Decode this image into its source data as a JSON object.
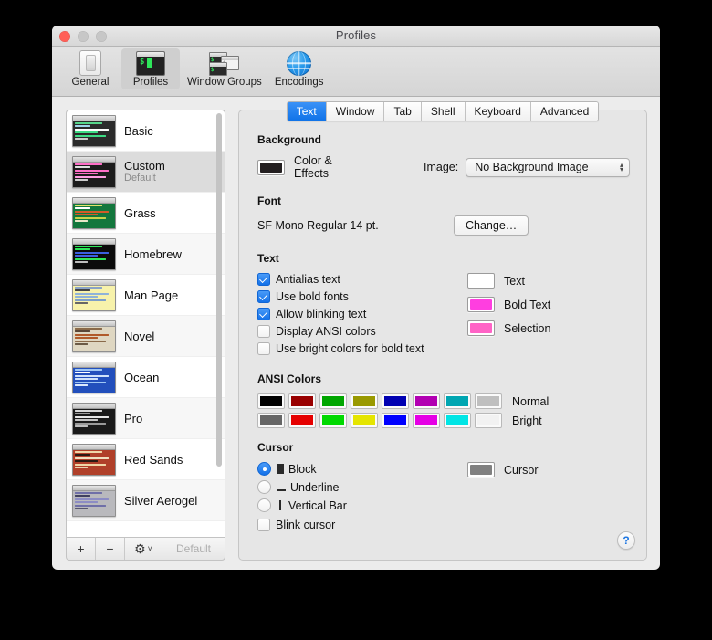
{
  "window": {
    "title": "Profiles",
    "traffic_lights": [
      "close",
      "minimize",
      "zoom"
    ]
  },
  "toolbar": {
    "items": [
      {
        "label": "General",
        "icon": "general-window-icon",
        "selected": false
      },
      {
        "label": "Profiles",
        "icon": "terminal-icon",
        "selected": true
      },
      {
        "label": "Window Groups",
        "icon": "window-groups-icon",
        "selected": false
      },
      {
        "label": "Encodings",
        "icon": "globe-icon",
        "selected": false
      }
    ]
  },
  "sidebar": {
    "profiles": [
      {
        "name": "Basic",
        "subtitle": "",
        "selected": false,
        "thumb": {
          "bg": "#2b2b2b",
          "lines": [
            "#56d68a",
            "#9fd6ea",
            "#ffffff",
            "#3ddc84",
            "#3ddc84",
            "#cccccc"
          ]
        }
      },
      {
        "name": "Custom",
        "subtitle": "Default",
        "selected": true,
        "thumb": {
          "bg": "#1c1c1c",
          "lines": [
            "#ff6ec7",
            "#e0e0e0",
            "#ff6ec7",
            "#ff6ec7",
            "#ff9de2",
            "#cccccc"
          ]
        }
      },
      {
        "name": "Grass",
        "subtitle": "",
        "selected": false,
        "thumb": {
          "bg": "#13773d",
          "lines": [
            "#e3e36a",
            "#ffffff",
            "#d35b29",
            "#d35b29",
            "#c9d14a",
            "#e8e8c8"
          ]
        }
      },
      {
        "name": "Homebrew",
        "subtitle": "",
        "selected": false,
        "thumb": {
          "bg": "#0b0b0b",
          "lines": [
            "#2ee65a",
            "#2ee65a",
            "#3b5fe0",
            "#3b5fe0",
            "#2ee65a",
            "#bdbdbd"
          ]
        }
      },
      {
        "name": "Man Page",
        "subtitle": "",
        "selected": false,
        "thumb": {
          "bg": "#f7f2ab",
          "lines": [
            "#8aa3c7",
            "#444444",
            "#8fb3d9",
            "#8fb3d9",
            "#7d9fc9",
            "#666666"
          ]
        }
      },
      {
        "name": "Novel",
        "subtitle": "",
        "selected": false,
        "thumb": {
          "bg": "#dfd7c2",
          "lines": [
            "#8a6a4a",
            "#5a4636",
            "#b05a2a",
            "#b05a2a",
            "#8a6a4a",
            "#6b5a45"
          ]
        }
      },
      {
        "name": "Ocean",
        "subtitle": "",
        "selected": false,
        "thumb": {
          "bg": "#224fbc",
          "lines": [
            "#9fc7f5",
            "#ffffff",
            "#cfe2fb",
            "#cfe2fb",
            "#9fc7f5",
            "#dbe9fd"
          ]
        }
      },
      {
        "name": "Pro",
        "subtitle": "",
        "selected": false,
        "thumb": {
          "bg": "#1a1a1a",
          "lines": [
            "#d8d8d8",
            "#9a9a9a",
            "#e6e6e6",
            "#c4c4c4",
            "#9a9a9a",
            "#bdbdbd"
          ]
        }
      },
      {
        "name": "Red Sands",
        "subtitle": "",
        "selected": false,
        "thumb": {
          "bg": "#b0402a",
          "lines": [
            "#f0d7a8",
            "#2a1a14",
            "#efe0c0",
            "#2a1a14",
            "#f0d7a8",
            "#e8d2b0"
          ]
        }
      },
      {
        "name": "Silver Aerogel",
        "subtitle": "",
        "selected": false,
        "thumb": {
          "bg": "#b9b9bd",
          "lines": [
            "#6f6fa8",
            "#404060",
            "#8c8cc4",
            "#8c8cc4",
            "#6f6fa8",
            "#55556e"
          ]
        }
      }
    ],
    "footer": {
      "add_label": "+",
      "remove_label": "−",
      "gear_label": "⚙",
      "gear_chevron": "˅",
      "default_label": "Default"
    }
  },
  "tabs": [
    {
      "label": "Text",
      "active": true
    },
    {
      "label": "Window",
      "active": false
    },
    {
      "label": "Tab",
      "active": false
    },
    {
      "label": "Shell",
      "active": false
    },
    {
      "label": "Keyboard",
      "active": false
    },
    {
      "label": "Advanced",
      "active": false
    }
  ],
  "background": {
    "section": "Background",
    "color_effects_label": "Color & Effects",
    "color_swatch": "#231f20",
    "image_label": "Image:",
    "image_value": "No Background Image"
  },
  "font": {
    "section": "Font",
    "value": "SF Mono Regular 14 pt.",
    "change_label": "Change…"
  },
  "text": {
    "section": "Text",
    "checkboxes": [
      {
        "label": "Antialias text",
        "checked": true
      },
      {
        "label": "Use bold fonts",
        "checked": true
      },
      {
        "label": "Allow blinking text",
        "checked": true
      },
      {
        "label": "Display ANSI colors",
        "checked": false
      },
      {
        "label": "Use bright colors for bold text",
        "checked": false
      }
    ],
    "swatches": [
      {
        "label": "Text",
        "color": "#ffffff"
      },
      {
        "label": "Bold Text",
        "color": "#ff3ee0"
      },
      {
        "label": "Selection",
        "color": "#ff63c6"
      }
    ]
  },
  "ansi": {
    "section": "ANSI Colors",
    "rows": [
      {
        "label": "Normal",
        "colors": [
          "#000000",
          "#990000",
          "#00a600",
          "#999900",
          "#0000b2",
          "#b200b2",
          "#00a6b2",
          "#bfbfbf"
        ]
      },
      {
        "label": "Bright",
        "colors": [
          "#666666",
          "#e50000",
          "#00d900",
          "#e5e500",
          "#0000ff",
          "#e500e5",
          "#00e5e5",
          "#f2f2f2"
        ]
      }
    ]
  },
  "cursor": {
    "section": "Cursor",
    "options": [
      {
        "label": "Block",
        "selected": true,
        "glyph": "block"
      },
      {
        "label": "Underline",
        "selected": false,
        "glyph": "underline"
      },
      {
        "label": "Vertical Bar",
        "selected": false,
        "glyph": "bar"
      }
    ],
    "blink": {
      "label": "Blink cursor",
      "checked": false
    },
    "swatch": {
      "label": "Cursor",
      "color": "#808080"
    }
  },
  "help": {
    "label": "?"
  }
}
